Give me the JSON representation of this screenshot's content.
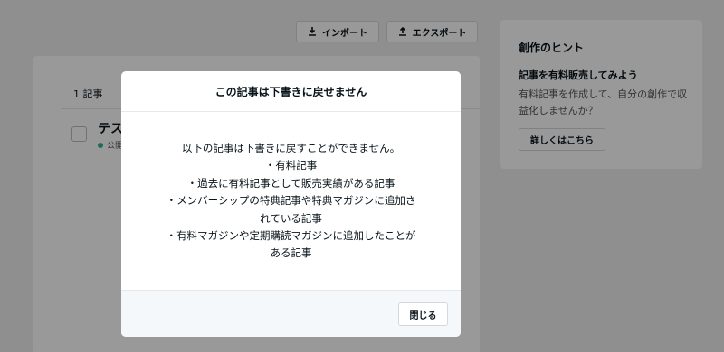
{
  "toolbar": {
    "import_label": "インポート",
    "export_label": "エクスポート",
    "import_icon": "download-icon",
    "export_icon": "upload-icon"
  },
  "list": {
    "count_label": "1 記事",
    "article": {
      "title": "テス",
      "status": "公開"
    }
  },
  "hint": {
    "heading": "創作のヒント",
    "subheading": "記事を有料販売してみよう",
    "body": "有料記事を作成して、自分の創作で収益化しませんか？",
    "button_label": "詳しくはこちら"
  },
  "modal": {
    "title": "この記事は下書きに戻せません",
    "body_lines": [
      "以下の記事は下書きに戻すことができません。",
      "・有料記事",
      "・過去に有料記事として販売実績がある記事",
      "・メンバーシップの特典記事や特典マガジンに追加さ",
      "れている記事",
      "・有料マガジンや定期購読マガジンに追加したことが",
      "ある記事"
    ],
    "close_label": "閉じる"
  },
  "colors": {
    "status_dot": "#2cb696",
    "overlay": "rgba(0,0,0,0.4)",
    "footer_bg": "#f5f8fa"
  }
}
